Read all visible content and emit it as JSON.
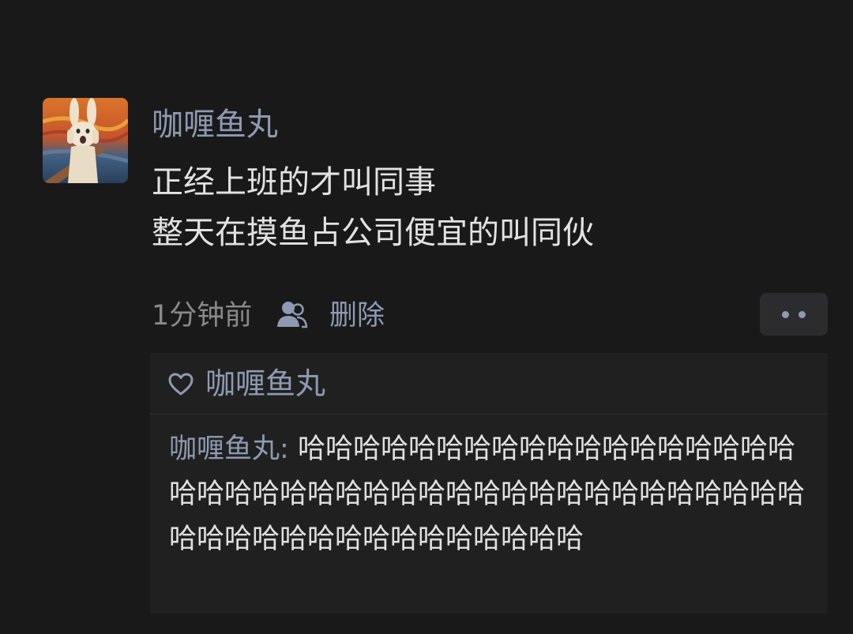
{
  "post": {
    "author": "咖喱鱼丸",
    "lines": [
      "正经上班的才叫同事",
      "整天在摸鱼占公司便宜的叫同伙"
    ],
    "time": "1分钟前",
    "delete_label": "删除",
    "user_icon": "user-icon",
    "more_icon": "more-dots-icon"
  },
  "likes": {
    "icon": "heart-icon",
    "names": "咖喱鱼丸"
  },
  "reply": {
    "author": "咖喱鱼丸",
    "separator": ":",
    "text": " 哈哈哈哈哈哈哈哈哈哈哈哈哈哈哈哈哈哈哈哈哈哈哈哈哈哈哈哈哈哈哈哈哈哈哈哈哈哈哈哈哈哈哈哈哈哈哈哈哈哈哈哈哈哈哈哈"
  },
  "colors": {
    "background": "#191919",
    "name_blue": "#8e9ab2",
    "text": "#e2e2e2",
    "panel": "#202020"
  }
}
